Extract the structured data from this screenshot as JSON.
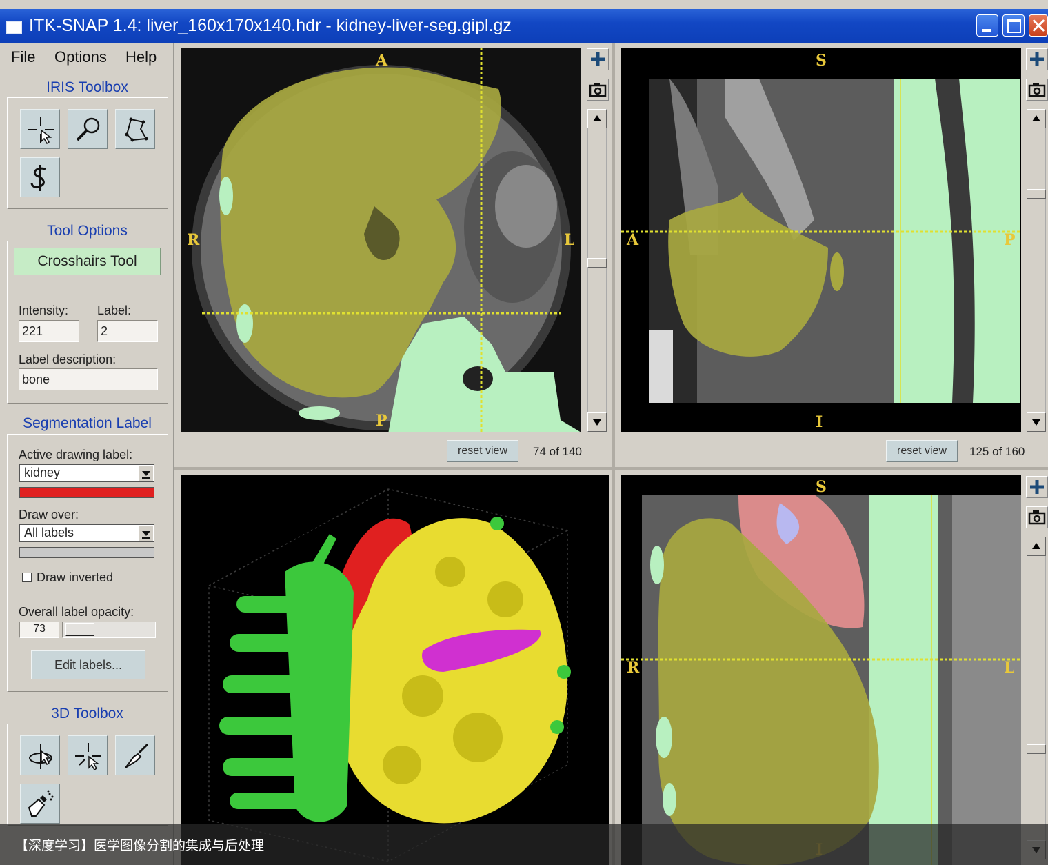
{
  "window": {
    "title": "ITK-SNAP 1.4: liver_160x170x140.hdr - kidney-liver-seg.gipl.gz"
  },
  "menu": {
    "file": "File",
    "options": "Options",
    "help": "Help"
  },
  "iris_toolbox": {
    "title": "IRIS Toolbox",
    "tools": [
      "crosshairs-icon",
      "zoom-icon",
      "polygon-icon",
      "snake-icon"
    ]
  },
  "tool_options": {
    "title": "Tool Options",
    "active_tool": "Crosshairs Tool",
    "intensity_label": "Intensity:",
    "intensity_value": "221",
    "label_label": "Label:",
    "label_value": "2",
    "description_label": "Label description:",
    "description_value": "bone"
  },
  "segmentation_label": {
    "title": "Segmentation Label",
    "active_label_caption": "Active drawing label:",
    "active_label": "kidney",
    "active_label_color": "#e02020",
    "draw_over_caption": "Draw over:",
    "draw_over": "All labels",
    "draw_inverted": "Draw inverted",
    "opacity_caption": "Overall label opacity:",
    "opacity_value": "73",
    "edit_labels": "Edit labels..."
  },
  "toolbox_3d": {
    "title": "3D Toolbox",
    "tools": [
      "rotate-icon",
      "crosshairs-3d-icon",
      "scalpel-icon",
      "spraypaint-icon"
    ]
  },
  "views": {
    "axial": {
      "top": "A",
      "bottom": "P",
      "left": "R",
      "right": "L",
      "reset": "reset view",
      "slice": "74 of 140"
    },
    "sagittal": {
      "top": "S",
      "bottom": "I",
      "left": "A",
      "right": "P",
      "reset": "reset view",
      "slice": "125 of 160"
    },
    "coronal": {
      "top": "S",
      "bottom": "I",
      "left": "R",
      "right": "L"
    }
  },
  "colors": {
    "liver": "#a8a840",
    "bone": "#b8f0c0",
    "kidney": "#e02020",
    "spine_3d": "#3cc83c",
    "liver_3d": "#e8dc30",
    "vessel_3d": "#d030d0"
  },
  "caption": "【深度学习】医学图像分割的集成与后处理"
}
